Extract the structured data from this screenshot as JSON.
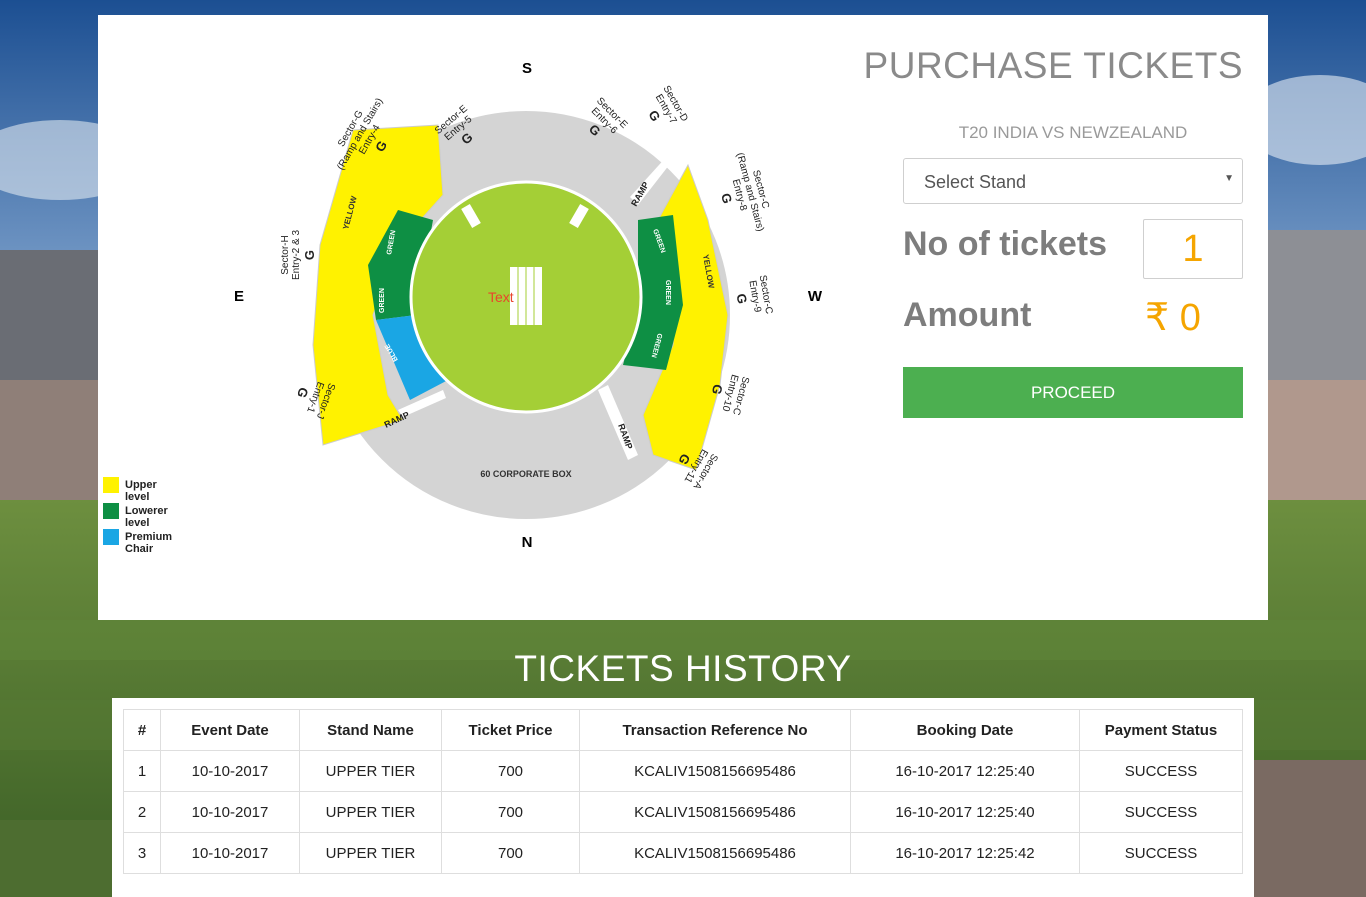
{
  "stadium": {
    "directions": {
      "north": "N",
      "south": "S",
      "east": "E",
      "west": "W"
    },
    "center_label": "Text",
    "sectors": [
      {
        "name": "Sector-G",
        "sub": "(Ramp and Stairs)",
        "entry": "Entry-4"
      },
      {
        "name": "Sector-E",
        "entry": "Entry-5"
      },
      {
        "name": "Sector-E",
        "entry": "Entry-6"
      },
      {
        "name": "Sector-D",
        "entry": "Entry-7"
      },
      {
        "name": "Sector-C",
        "sub": "(Ramp and Stairs)",
        "entry": "Entry-8"
      },
      {
        "name": "Sector-C",
        "entry": "Entry-9"
      },
      {
        "name": "Sector-C",
        "entry": "Entry-10"
      },
      {
        "name": "Sector-A",
        "entry": "Entry-11"
      },
      {
        "name": "Sector-J",
        "entry": "Entry-1"
      },
      {
        "name": "Sector-H",
        "entry": "Entry-2 & 3"
      }
    ],
    "gate": "G",
    "zone_labels": {
      "yellow": "YELLOW",
      "green": "GREEN",
      "blue": "BLUE",
      "ramp": "RAMP",
      "corporate": "60 CORPORATE BOX"
    },
    "legend": [
      {
        "label": "Upper level",
        "color": "#fff200"
      },
      {
        "label": "Lowerer level",
        "color": "#0e8f44"
      },
      {
        "label": "Premium Chair",
        "color": "#1aa6e4"
      }
    ]
  },
  "purchase": {
    "title": "PURCHASE TICKETS",
    "event": "T20 INDIA VS NEWZEALAND",
    "select_placeholder": "Select Stand",
    "tickets_label": "No of tickets",
    "tickets_value": "1",
    "amount_label": "Amount",
    "amount_value": "₹ 0",
    "proceed_label": "PROCEED"
  },
  "history": {
    "title": "TICKETS HISTORY",
    "columns": [
      "#",
      "Event Date",
      "Stand Name",
      "Ticket Price",
      "Transaction Reference No",
      "Booking Date",
      "Payment Status"
    ],
    "rows": [
      [
        "1",
        "10-10-2017",
        "UPPER TIER",
        "700",
        "KCALIV1508156695486",
        "16-10-2017 12:25:40",
        "SUCCESS"
      ],
      [
        "2",
        "10-10-2017",
        "UPPER TIER",
        "700",
        "KCALIV1508156695486",
        "16-10-2017 12:25:40",
        "SUCCESS"
      ],
      [
        "3",
        "10-10-2017",
        "UPPER TIER",
        "700",
        "KCALIV1508156695486",
        "16-10-2017 12:25:42",
        "SUCCESS"
      ]
    ]
  }
}
